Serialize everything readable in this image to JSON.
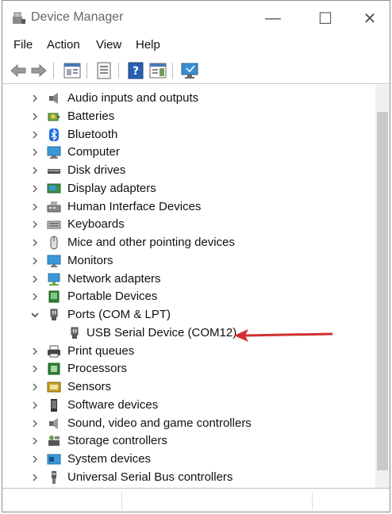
{
  "window": {
    "title": "Device Manager",
    "minimize": "—",
    "maximize": "☐",
    "close": "✕"
  },
  "menu": [
    "File",
    "Action",
    "View",
    "Help"
  ],
  "toolbar": [
    "back-arrow-icon",
    "forward-arrow-icon",
    "properties-panel-icon",
    "device-list-icon",
    "help-icon",
    "action-pane-icon",
    "monitor-scan-icon"
  ],
  "tree": [
    {
      "label": "Audio inputs and outputs",
      "icon": "speaker-icon",
      "expanded": false
    },
    {
      "label": "Batteries",
      "icon": "battery-icon",
      "expanded": false
    },
    {
      "label": "Bluetooth",
      "icon": "bluetooth-icon",
      "expanded": false
    },
    {
      "label": "Computer",
      "icon": "computer-icon",
      "expanded": false
    },
    {
      "label": "Disk drives",
      "icon": "disk-drive-icon",
      "expanded": false
    },
    {
      "label": "Display adapters",
      "icon": "display-adapter-icon",
      "expanded": false
    },
    {
      "label": "Human Interface Devices",
      "icon": "hid-icon",
      "expanded": false
    },
    {
      "label": "Keyboards",
      "icon": "keyboard-icon",
      "expanded": false
    },
    {
      "label": "Mice and other pointing devices",
      "icon": "mouse-icon",
      "expanded": false
    },
    {
      "label": "Monitors",
      "icon": "monitor-icon",
      "expanded": false
    },
    {
      "label": "Network adapters",
      "icon": "network-icon",
      "expanded": false
    },
    {
      "label": "Portable Devices",
      "icon": "portable-device-icon",
      "expanded": false
    },
    {
      "label": "Ports (COM & LPT)",
      "icon": "port-icon",
      "expanded": true
    },
    {
      "label": "USB Serial Device (COM12)",
      "icon": "port-icon",
      "child": true
    },
    {
      "label": "Print queues",
      "icon": "printer-icon",
      "expanded": false
    },
    {
      "label": "Processors",
      "icon": "processor-icon",
      "expanded": false
    },
    {
      "label": "Sensors",
      "icon": "sensor-icon",
      "expanded": false
    },
    {
      "label": "Software devices",
      "icon": "software-device-icon",
      "expanded": false
    },
    {
      "label": "Sound, video and game controllers",
      "icon": "sound-icon",
      "expanded": false
    },
    {
      "label": "Storage controllers",
      "icon": "storage-icon",
      "expanded": false
    },
    {
      "label": "System devices",
      "icon": "system-device-icon",
      "expanded": false
    },
    {
      "label": "Universal Serial Bus controllers",
      "icon": "usb-icon",
      "expanded": false
    }
  ],
  "colors": {
    "accent": "#2a6fc9",
    "arrow": "#d32f2f"
  }
}
